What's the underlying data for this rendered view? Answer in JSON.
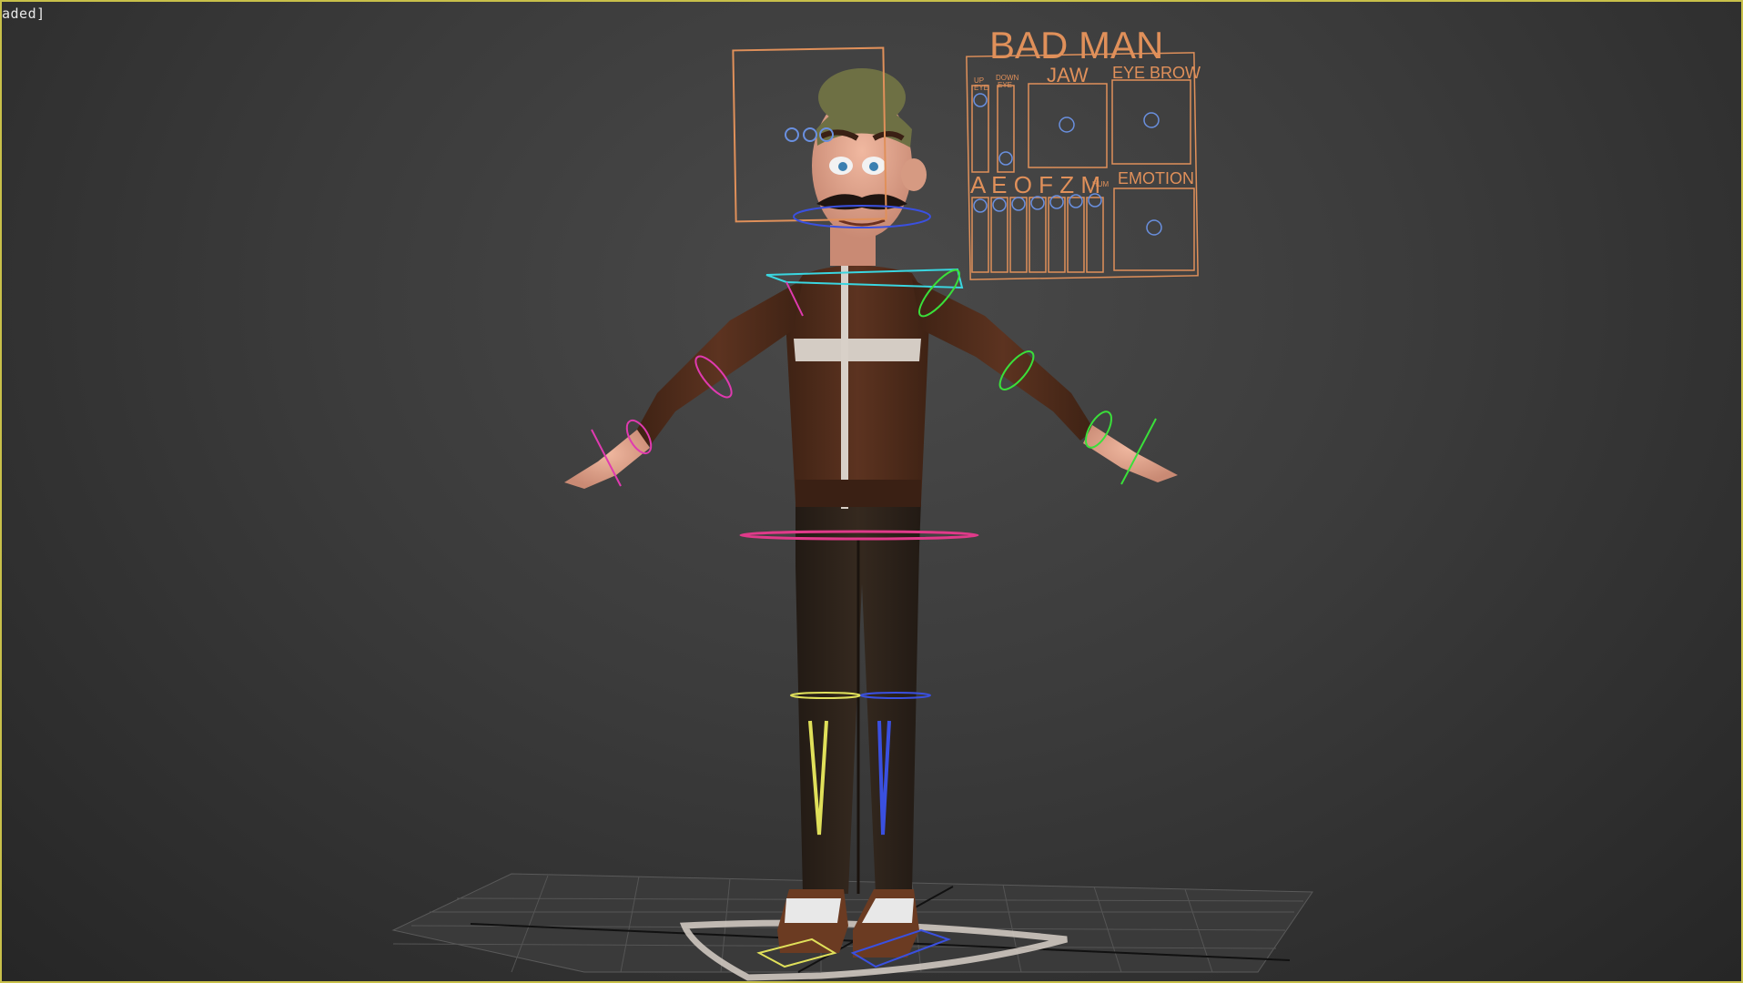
{
  "viewport": {
    "label": "aded]",
    "border_color": "#c8c04a"
  },
  "facial_gui": {
    "title": "BAD MAN",
    "up_eye_label_1": "UP",
    "up_eye_label_2": "EYE",
    "down_eye_label_1": "DOWN",
    "down_eye_label_2": "EYE",
    "jaw_label": "JAW",
    "eyebrow_label": "EYE BROW",
    "phonemes_label": "A E O F Z M",
    "hum_label": "HUM",
    "emotion_label": "EMOTION",
    "color": "#e0905a"
  },
  "character": {
    "name": "BAD MAN",
    "controls": [
      "head-frame-control",
      "eye-controls",
      "jaw-control",
      "neck-control",
      "shoulder-control-left",
      "shoulder-control-right",
      "elbow-control-left",
      "elbow-control-right",
      "wrist-control-left",
      "wrist-control-right",
      "hip-control",
      "knee-control-left",
      "knee-control-right",
      "foot-control-left",
      "foot-control-right",
      "root-control"
    ]
  }
}
